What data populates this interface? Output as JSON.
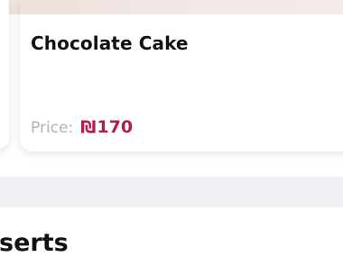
{
  "product_card": {
    "title": "Chocolate Cake",
    "price_label": "Price:",
    "currency_symbol": "₪",
    "price_amount": "170"
  },
  "section": {
    "title": "serts"
  },
  "colors": {
    "price_accent": "#b01d4a",
    "divider": "#f0eff3",
    "muted_text": "#b2b2b2"
  },
  "icons": {
    "currency": "shekel-icon"
  }
}
